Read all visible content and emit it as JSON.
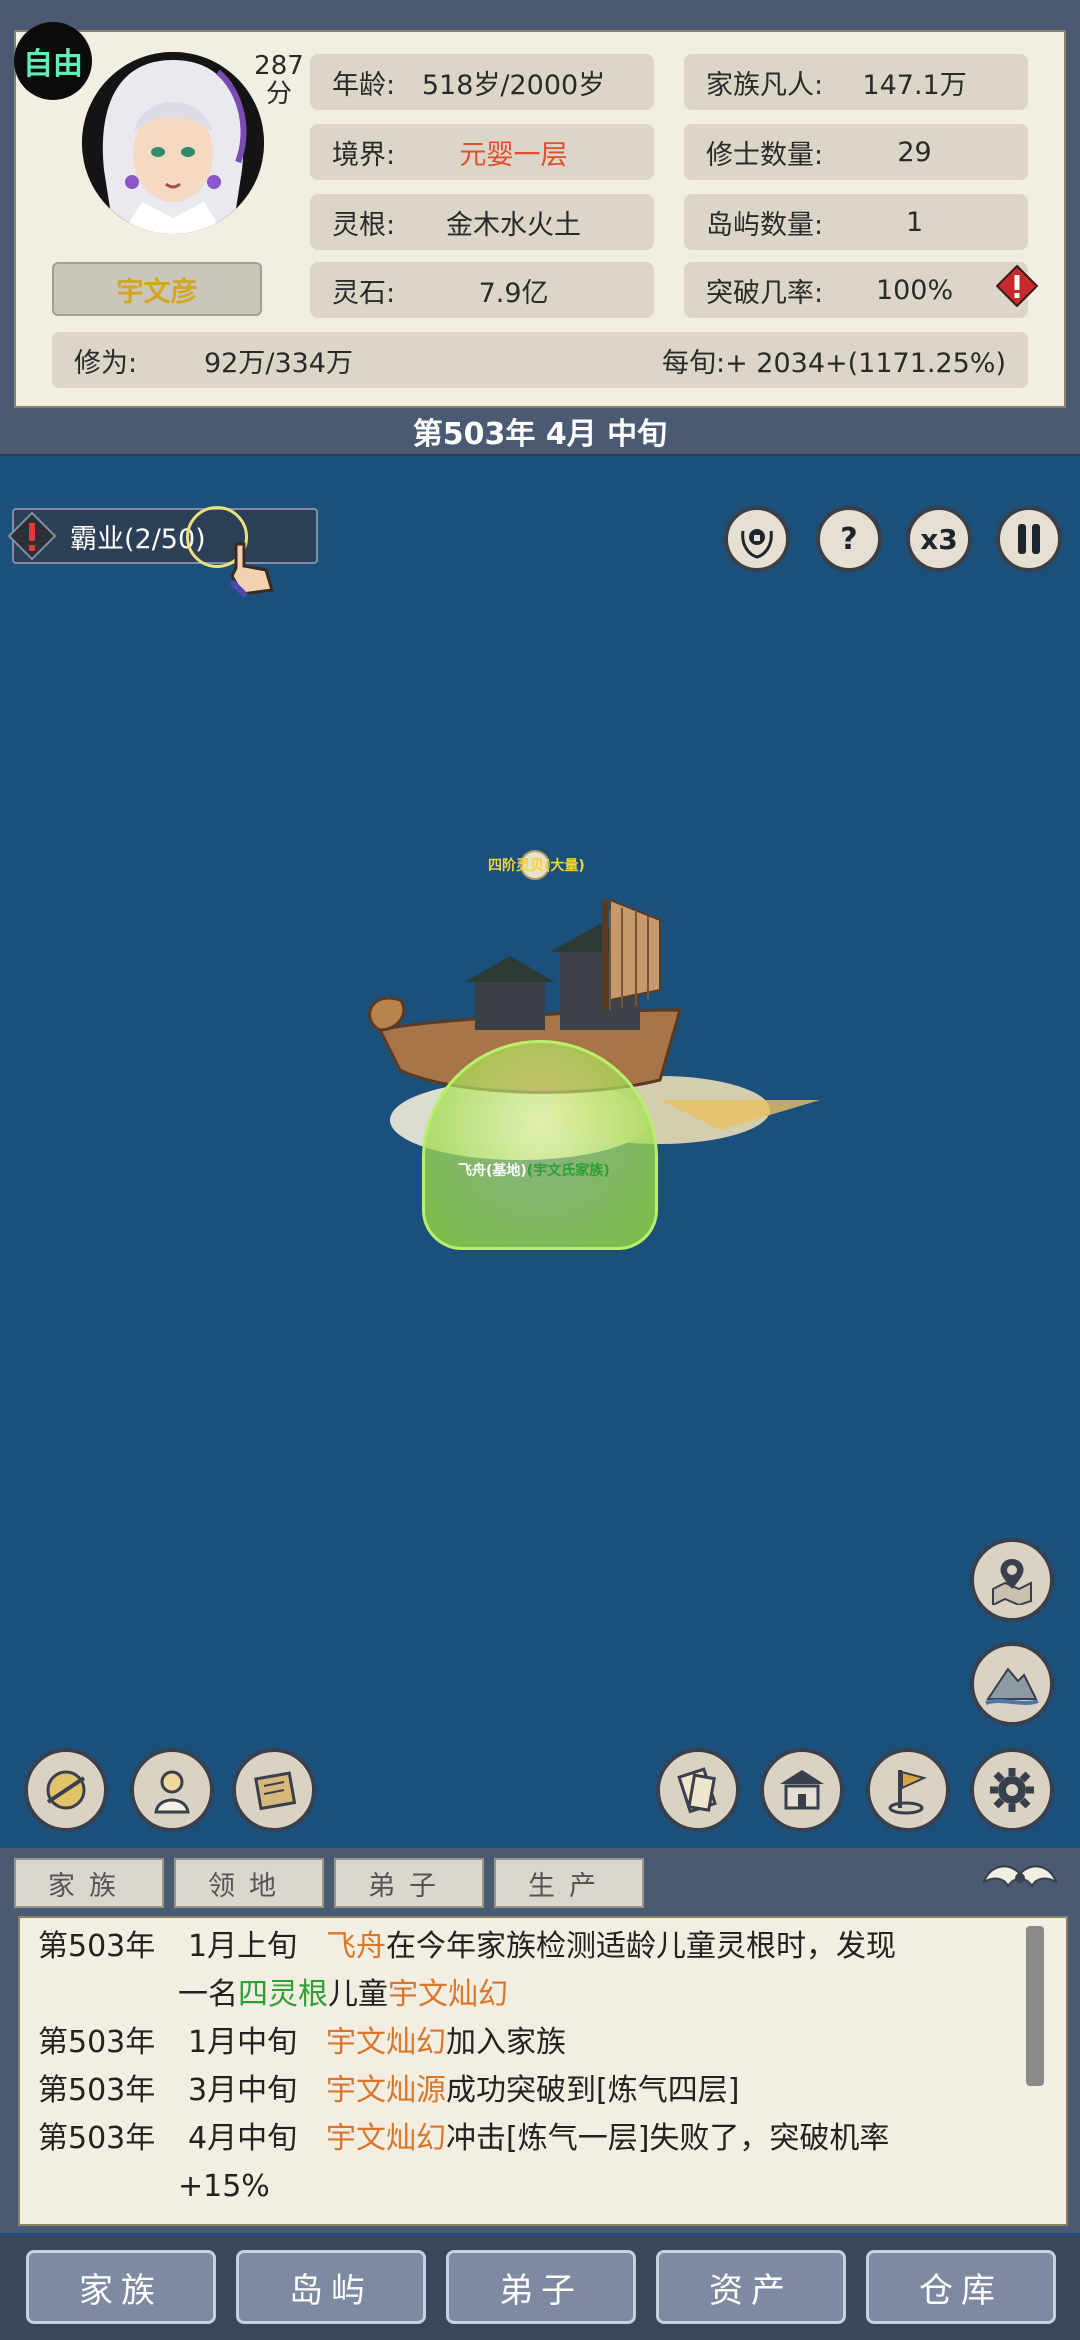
{
  "player": {
    "status_badge": "自由",
    "score_value": "287",
    "score_unit": "分",
    "name": "宇文彦"
  },
  "stats": {
    "age": {
      "label": "年龄:",
      "value": "518岁/2000岁"
    },
    "realm": {
      "label": "境界:",
      "value": "元婴一层"
    },
    "spirit_root": {
      "label": "灵根:",
      "value": "金木水火土"
    },
    "spirit_stones": {
      "label": "灵石:",
      "value": "7.9亿"
    },
    "mortals": {
      "label": "家族凡人:",
      "value": "147.1万"
    },
    "cultivators": {
      "label": "修士数量:",
      "value": "29"
    },
    "islands": {
      "label": "岛屿数量:",
      "value": "1"
    },
    "breakthrough": {
      "label": "突破几率:",
      "value": "100%"
    },
    "cultivation": {
      "label": "修为:",
      "value": "92万/334万"
    },
    "per_period": {
      "label": "每旬:",
      "value": "+ 2034+(1171.25%)"
    }
  },
  "date": "第503年 4月 中旬",
  "quest": {
    "label": "霸业(2/50)"
  },
  "top_buttons": {
    "speed": "x3"
  },
  "scene": {
    "treasure_label": "四阶灵贝(大量)",
    "ship_label_prefix": "飞舟(基地)",
    "ship_label_owner": "(宇文氏家族)"
  },
  "log_tabs": [
    "家族",
    "领地",
    "弟子",
    "生产"
  ],
  "log_entries": [
    {
      "year": "第503年",
      "month": "1月上旬",
      "parts": [
        {
          "t": "飞舟",
          "c": "orange"
        },
        {
          "t": "在今年家族检测适龄儿童灵根时，发现",
          "c": "plain"
        }
      ]
    },
    {
      "year": "",
      "month": "",
      "parts": [
        {
          "t": "一名",
          "c": "plain"
        },
        {
          "t": "四灵根",
          "c": "green"
        },
        {
          "t": "儿童",
          "c": "plain"
        },
        {
          "t": "宇文灿幻",
          "c": "orange"
        }
      ]
    },
    {
      "year": "第503年",
      "month": "1月中旬",
      "parts": [
        {
          "t": "宇文灿幻",
          "c": "orange"
        },
        {
          "t": "加入家族",
          "c": "plain"
        }
      ]
    },
    {
      "year": "第503年",
      "month": "3月中旬",
      "parts": [
        {
          "t": "宇文灿源",
          "c": "orange"
        },
        {
          "t": "成功突破到[炼气四层]",
          "c": "plain"
        }
      ]
    },
    {
      "year": "第503年",
      "month": "4月中旬",
      "parts": [
        {
          "t": "宇文灿幻",
          "c": "orange"
        },
        {
          "t": "冲击[炼气一层]失败了，突破机率",
          "c": "plain"
        }
      ]
    },
    {
      "year": "",
      "month": "",
      "parts": [
        {
          "t": "+15%",
          "c": "plain"
        }
      ]
    }
  ],
  "bottom_nav": [
    "家族",
    "岛屿",
    "弟子",
    "资产",
    "仓库"
  ],
  "colors": {
    "panel_bg": "#f3eee2",
    "sea": "#1b507c",
    "highlight_orange": "#d9782c",
    "highlight_green": "#2e9f33",
    "realm_red": "#e24d2c",
    "name_gold": "#d4a423"
  }
}
